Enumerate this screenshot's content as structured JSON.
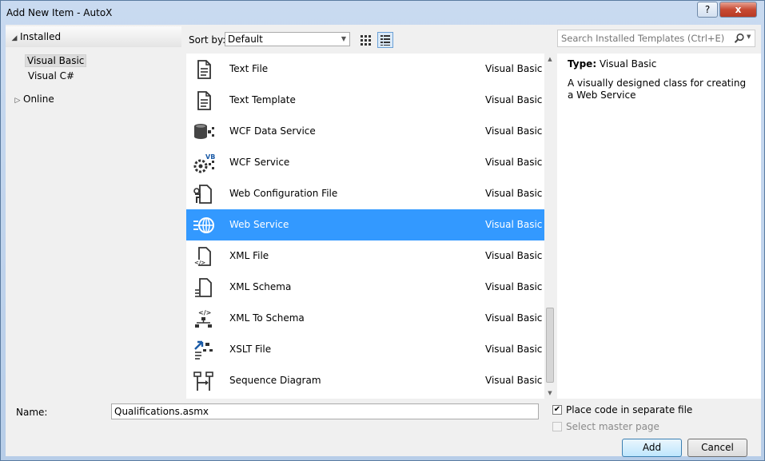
{
  "window": {
    "title": "Add New Item - AutoX",
    "help_label": "?",
    "close_label": "x"
  },
  "tree": {
    "installed_label": "Installed",
    "visual_basic": "Visual Basic",
    "visual_csharp": "Visual C#",
    "online_label": "Online"
  },
  "toolbar": {
    "sort_label": "Sort by:",
    "sort_value": "Default"
  },
  "items": [
    {
      "name": "Text File",
      "category": "Visual Basic",
      "icon": "document-icon"
    },
    {
      "name": "Text Template",
      "category": "Visual Basic",
      "icon": "document-icon"
    },
    {
      "name": "WCF Data Service",
      "category": "Visual Basic",
      "icon": "data-service-icon"
    },
    {
      "name": "WCF Service",
      "category": "Visual Basic",
      "icon": "wcf-gear-icon"
    },
    {
      "name": "Web Configuration File",
      "category": "Visual Basic",
      "icon": "config-file-icon"
    },
    {
      "name": "Web Service",
      "category": "Visual Basic",
      "icon": "globe-service-icon"
    },
    {
      "name": "XML File",
      "category": "Visual Basic",
      "icon": "xml-file-icon"
    },
    {
      "name": "XML Schema",
      "category": "Visual Basic",
      "icon": "xml-schema-icon"
    },
    {
      "name": "XML To Schema",
      "category": "Visual Basic",
      "icon": "xml-to-schema-icon"
    },
    {
      "name": "XSLT File",
      "category": "Visual Basic",
      "icon": "xslt-icon"
    },
    {
      "name": "Sequence Diagram",
      "category": "Visual Basic",
      "icon": "sequence-diagram-icon"
    }
  ],
  "selected_index": 5,
  "search": {
    "placeholder": "Search Installed Templates (Ctrl+E)"
  },
  "details": {
    "type_label": "Type:",
    "type_value": "Visual Basic",
    "description": "A visually designed class for creating a Web Service"
  },
  "bottom": {
    "name_label": "Name:",
    "name_value": "Qualifications.asmx",
    "place_code_label": "Place code in separate file",
    "place_code_checked": true,
    "master_page_label": "Select master page",
    "master_page_checked": false,
    "add_label": "Add",
    "cancel_label": "Cancel"
  },
  "colors": {
    "selection": "#3399ff",
    "dialog_bg": "#f0f0f0"
  }
}
